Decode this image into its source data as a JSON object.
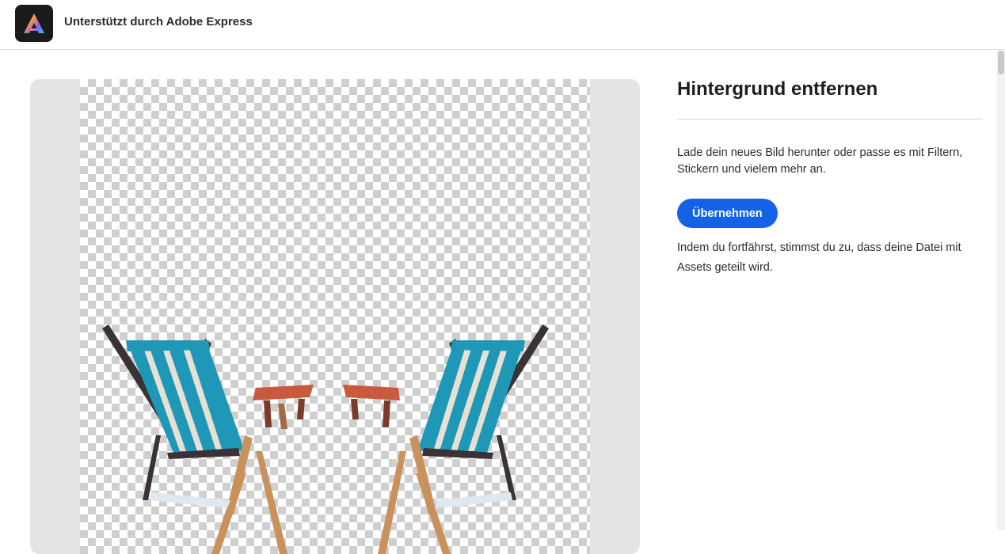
{
  "header": {
    "logo_icon": "adobe-express-logo-icon",
    "title": "Unterstützt durch Adobe Express"
  },
  "preview": {
    "image_subject": "two-deck-chairs-with-side-tables",
    "background": "transparent-checkerboard"
  },
  "panel": {
    "title": "Hintergrund entfernen",
    "description": "Lade dein neues Bild herunter oder passe es mit Filtern, Stickern und vielem mehr an.",
    "apply_label": "Übernehmen",
    "consent_text": "Indem du fortfährst, stimmst du zu, dass deine Datei mit Assets geteilt wird."
  },
  "colors": {
    "accent": "#1463e6",
    "checker_dark": "#cfcfcf",
    "chair_fabric": "#1f97b7",
    "chair_frame_dark": "#3a3235",
    "chair_frame_wood": "#c9925c",
    "table_top": "#c85b3e"
  }
}
